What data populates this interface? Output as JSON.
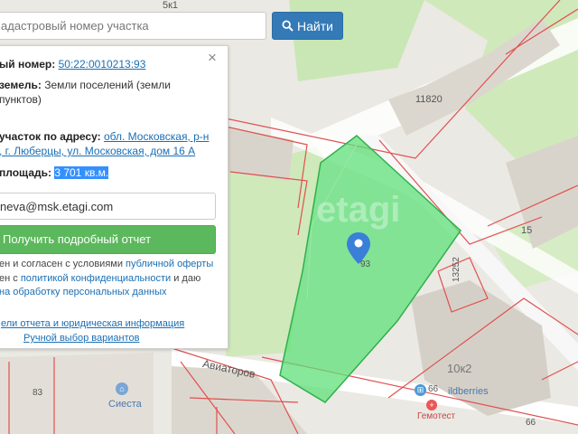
{
  "search": {
    "placeholder": "адастровый номер участка",
    "button_label": "Найти",
    "button_icon": "search-icon"
  },
  "panel": {
    "close_glyph": "×",
    "cadastral_label": "ый номер:",
    "cadastral_value": "50:22:0010213:93",
    "land_category_label": "земель:",
    "land_category_value_line1": "Земли поселений (земли",
    "land_category_value_line2": "пунктов)",
    "address_label": "участок по адресу:",
    "address_link_line1": "обл. Московская, р-н",
    "address_link_line2": ", г. Люберцы, ул. Московская, дом 16 А",
    "area_label": "площадь:",
    "area_value": "3 701 кв.м.",
    "email_value": "neva@msk.etagi.com",
    "report_button_label": "Получить подробный отчет",
    "consent_line1_text": "ен и согласен с условиями ",
    "consent_line1_link": "публичной оферты",
    "consent_line2_text": "ен с ",
    "consent_line2_link": "политикой конфиденциальности",
    "consent_line2_tail": " и даю",
    "consent_line3_link": "на обработку персональных данных",
    "details_link": "ели отчета и юридическая информация",
    "manual_link": "Ручной выбор вариантов"
  },
  "map": {
    "labels": [
      "5к1",
      "11820",
      "15",
      "93",
      "13252",
      "10к2",
      "83",
      "Сиеста",
      "66",
      "ildberries",
      "Гемотест",
      "66",
      "Авиаторов"
    ],
    "watermark": "etagi",
    "parcel_color": "#5fe07a",
    "pin_color": "#3a7fd8"
  }
}
